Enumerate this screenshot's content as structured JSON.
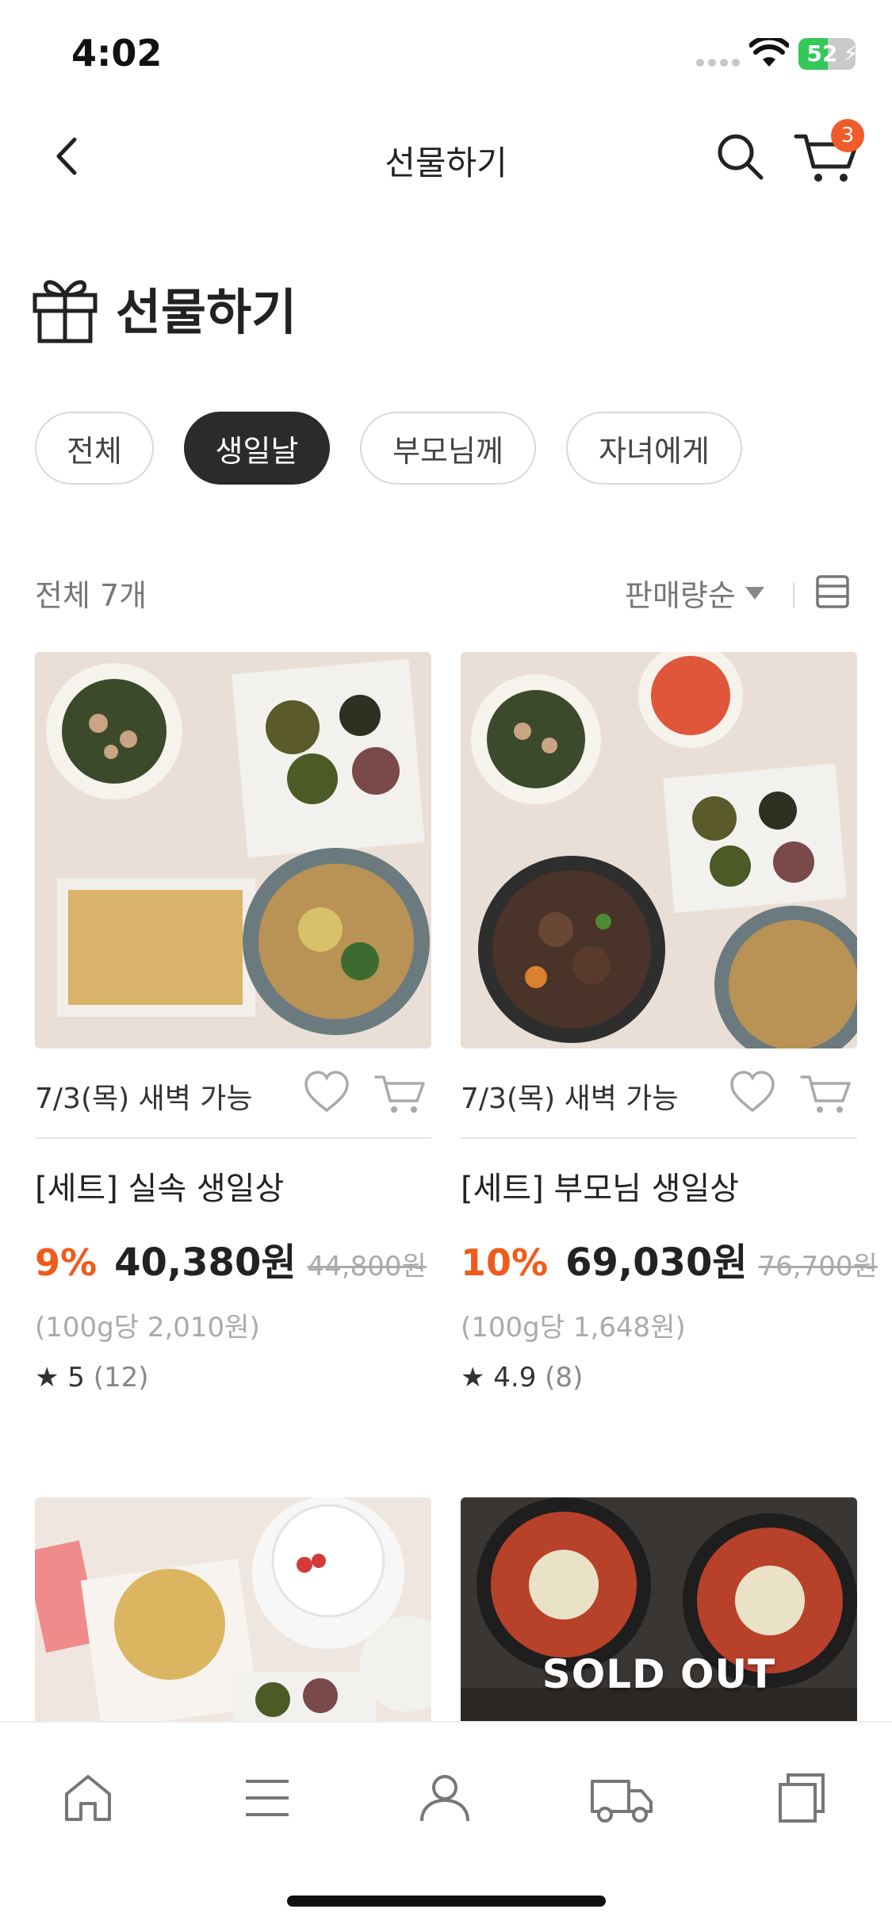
{
  "status_bar": {
    "time": "4:02",
    "battery": "52",
    "battery_level": 0.52
  },
  "header": {
    "title": "선물하기",
    "cart_count": "3"
  },
  "heading": {
    "title": "선물하기",
    "icon": "gift-icon"
  },
  "filters": [
    {
      "label": "전체",
      "active": false
    },
    {
      "label": "생일날",
      "active": true
    },
    {
      "label": "부모님께",
      "active": false
    },
    {
      "label": "자녀에게",
      "active": false
    }
  ],
  "list_bar": {
    "count": "전체 7개",
    "sort": "판매량순"
  },
  "products": [
    {
      "delivery": "7/3(목) 새벽 가능",
      "name": "[세트] 실속 생일상",
      "discount": "9%",
      "price": "40,380원",
      "original_price": "44,800원",
      "unit_price": "(100g당 2,010원)",
      "rating": "★ 5",
      "review_count": "(12)"
    },
    {
      "delivery": "7/3(목) 새벽 가능",
      "name": "[세트] 부모님 생일상",
      "discount": "10%",
      "price": "69,030원",
      "original_price": "76,700원",
      "unit_price": "(100g당 1,648원)",
      "rating": "★ 4.9",
      "review_count": "(8)"
    }
  ],
  "lower_products": [
    {
      "sold_out": ""
    },
    {
      "sold_out": "SOLD OUT"
    }
  ],
  "tabs": [
    {
      "icon": "home-icon"
    },
    {
      "icon": "menu-icon"
    },
    {
      "icon": "person-icon"
    },
    {
      "icon": "truck-icon"
    },
    {
      "icon": "copy-icon"
    }
  ],
  "colors": {
    "accent": "#f05b1c",
    "badge": "#f05b2b",
    "chip_active": "#2b2b2b"
  }
}
